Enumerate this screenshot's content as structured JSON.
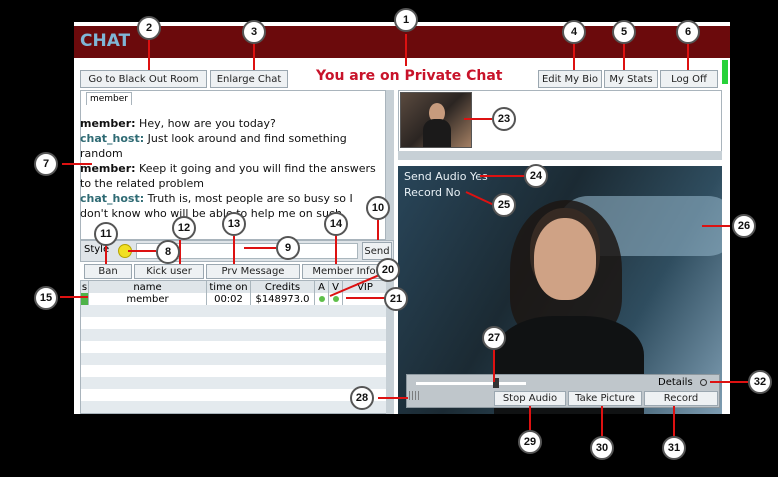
{
  "header": {
    "title": "CHAT"
  },
  "topbar": {
    "blackout_label": "Go to Black Out Room",
    "enlarge_label": "Enlarge Chat",
    "status_text": "You are on Private Chat",
    "edit_bio_label": "Edit My Bio",
    "stats_label": "My Stats",
    "logoff_label": "Log Off"
  },
  "chat": {
    "tab_label": "member",
    "messages": [
      {
        "user": "member:",
        "text": " Hey, how are you today?"
      },
      {
        "user": "chat_host:",
        "text": " Just look around and find something random"
      },
      {
        "user": "member:",
        "text": " Keep it going and you will find the answers to the related problem"
      },
      {
        "user": "chat_host:",
        "text": " Truth is, most people are so busy so I don't know who will be able to help me on such problem"
      }
    ],
    "style_label": "Style",
    "send_label": "Send"
  },
  "actions": {
    "ban_label": "Ban",
    "kick_label": "Kick user",
    "prv_message_label": "Prv Message",
    "member_info_label": "Member Info"
  },
  "table": {
    "headers": [
      "s",
      "name",
      "time on",
      "Credits",
      "A",
      "V",
      "VIP"
    ],
    "rows": [
      {
        "name": "member",
        "time": "00:02",
        "credits": "$148973.0"
      }
    ]
  },
  "video": {
    "send_audio": "Send Audio Yes",
    "record": "Record No",
    "details_label": "Details",
    "stop_audio_label": "Stop Audio",
    "take_picture_label": "Take Picture",
    "record_label": "Record"
  },
  "callouts": [
    "1",
    "2",
    "3",
    "4",
    "5",
    "6",
    "7",
    "8",
    "9",
    "10",
    "11",
    "12",
    "13",
    "14",
    "15",
    "20",
    "21",
    "23",
    "24",
    "25",
    "26",
    "27",
    "28",
    "29",
    "30",
    "31",
    "32"
  ],
  "colors": {
    "header_bg": "#6b0a0c",
    "title_red": "#c8132a",
    "title_blue": "#7fb6d6",
    "online_green": "#5fbf4a"
  }
}
